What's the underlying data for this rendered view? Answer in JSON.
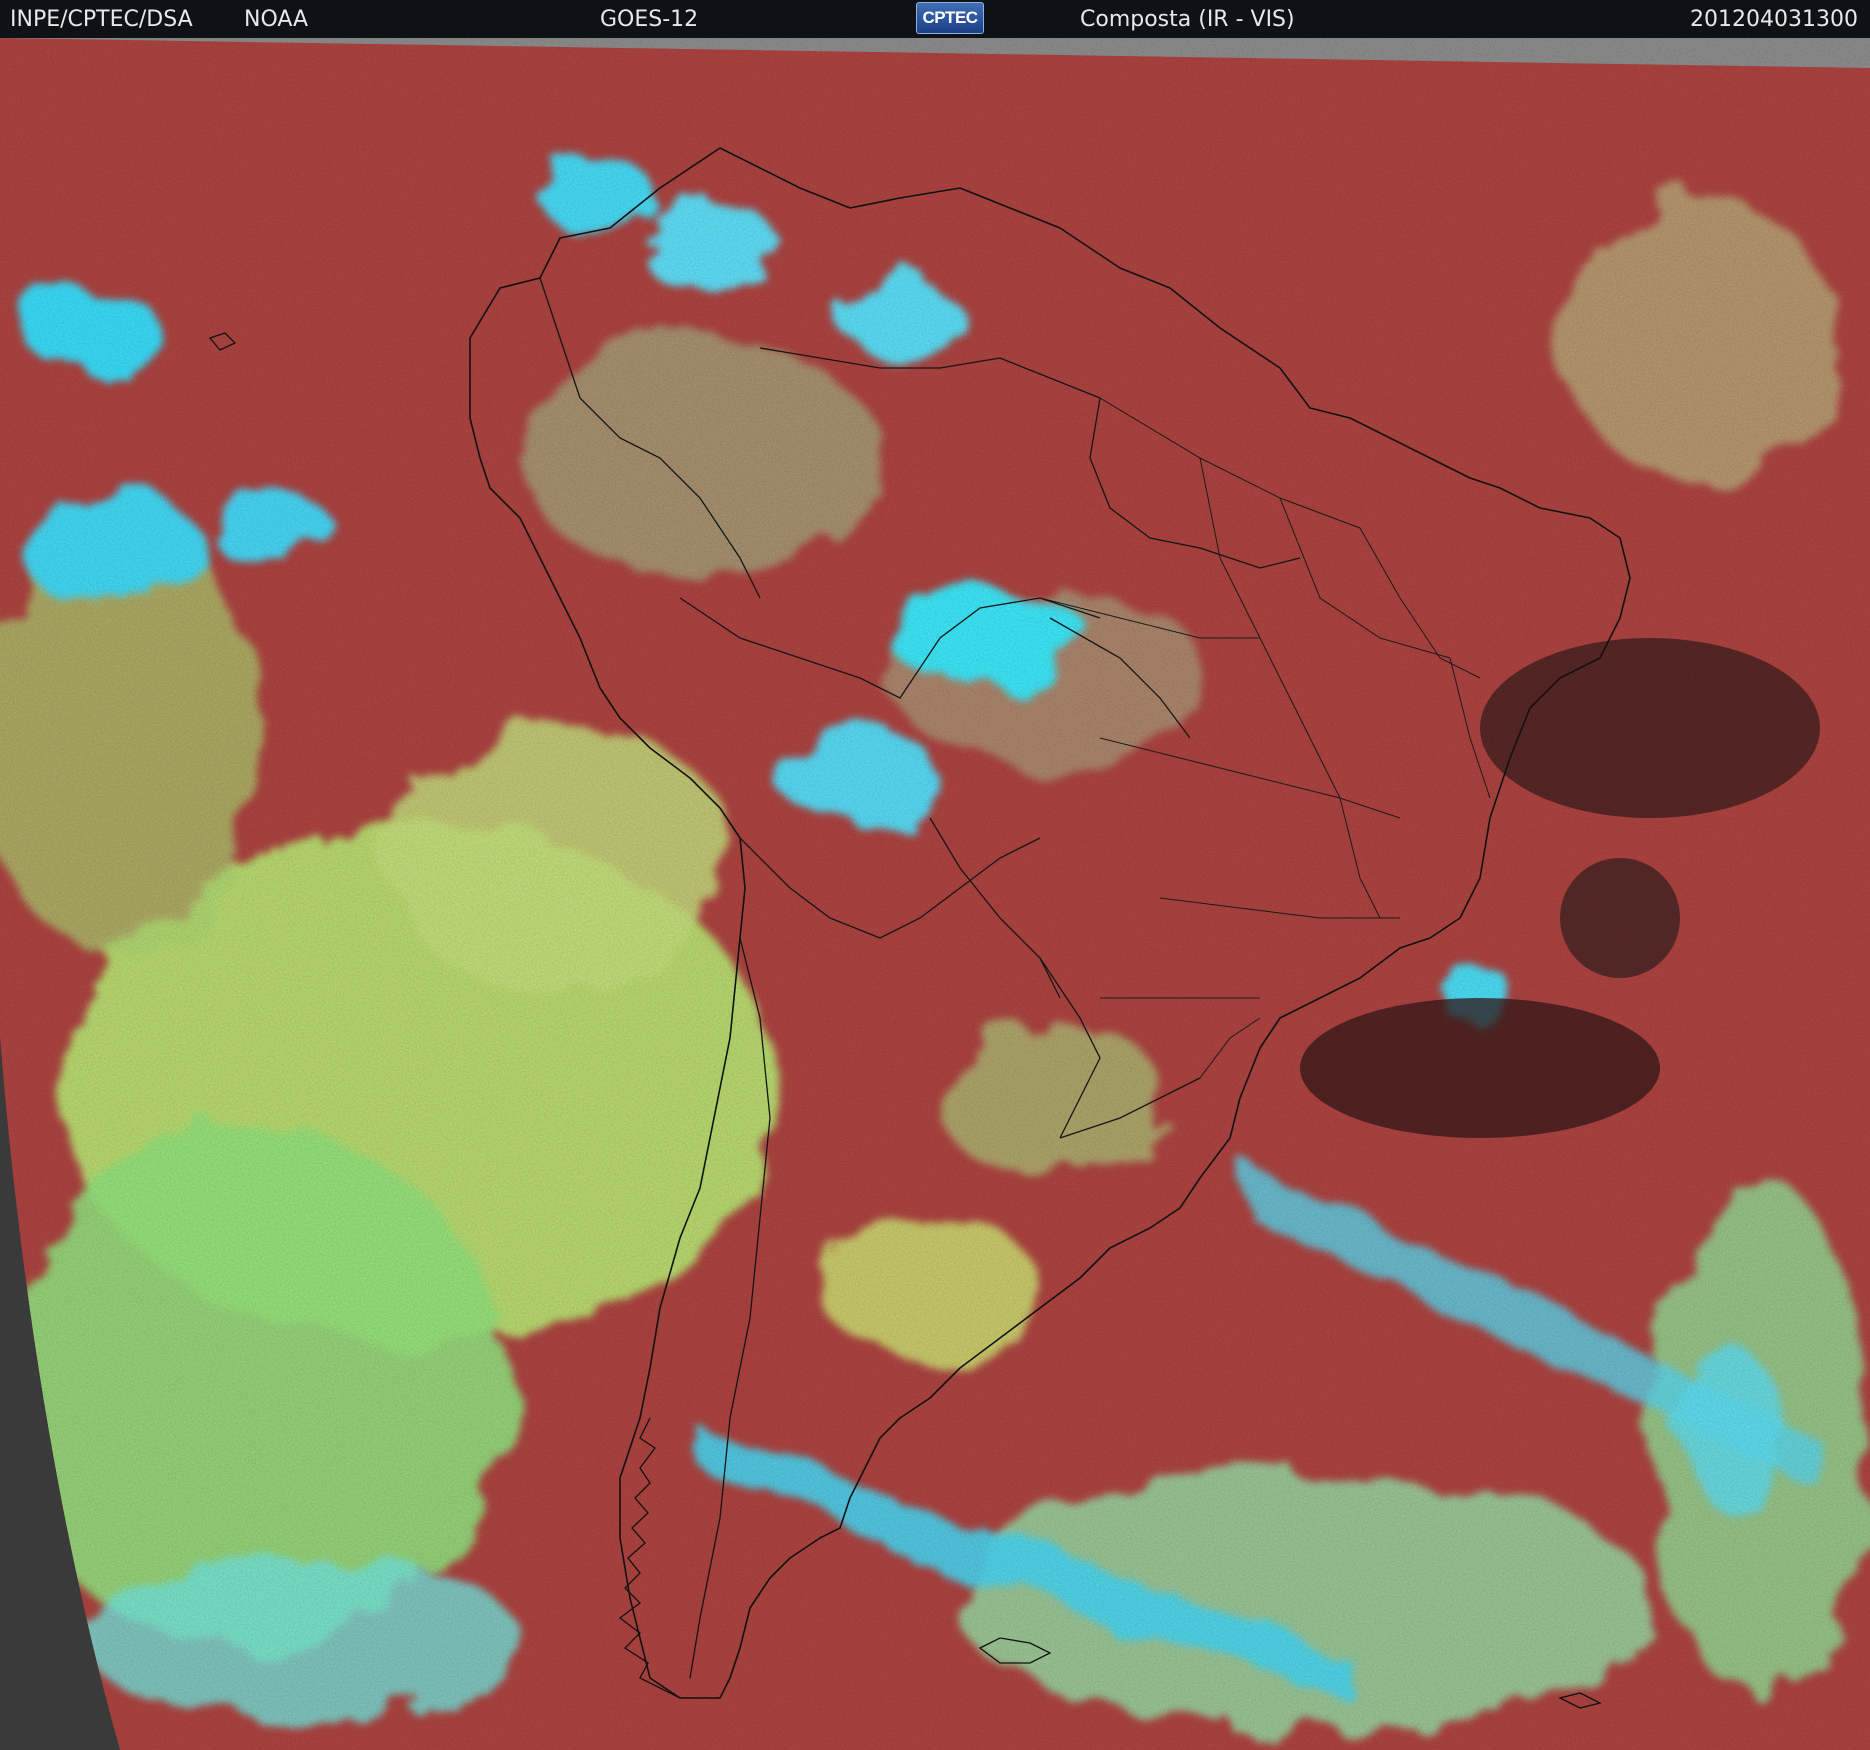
{
  "header": {
    "agency": "INPE/CPTEC/DSA",
    "source": "NOAA",
    "satellite": "GOES-12",
    "logo_text": "CPTEC",
    "product": "Composta (IR - VIS)",
    "timestamp": "201204031300"
  },
  "colors": {
    "header_bg": "#0e1216",
    "clear_sky_land_ocean": "#a9423f",
    "low_cloud": "#a7d868",
    "high_cold_cloud": "#35d8ee",
    "outside_disk": "#3a3a3a",
    "space_bar": "#8a8a8a",
    "coastlines_borders": "#111111"
  },
  "map": {
    "region": "South America",
    "layers": [
      "coastlines",
      "country-borders",
      "brazil-state-borders"
    ]
  }
}
